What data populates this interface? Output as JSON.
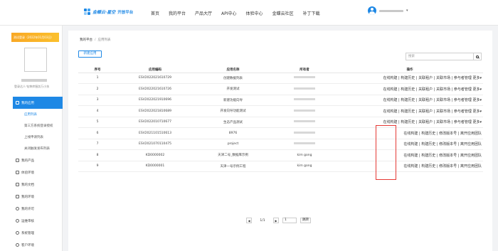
{
  "header": {
    "logo_text": "金蝶云·星空",
    "logo_sub": "开放平台",
    "nav": [
      "首页",
      "我的平台",
      "产品大厅",
      "API中心",
      "体验中心",
      "金蝶云社区",
      "补丁下载"
    ]
  },
  "sidebar": {
    "banner": "测试登录（2022年01月03日）",
    "profile_desc": "登录达人·钻坤库服务万小技",
    "items": [
      {
        "label": "我的应用",
        "icon": "app-icon",
        "active": true
      },
      {
        "label": "应用列表",
        "sub": true,
        "current": true
      },
      {
        "label": "第三方系统登录授权",
        "sub": true
      },
      {
        "label": "上线申请列表",
        "sub": true
      },
      {
        "label": "关闭触发发布列表",
        "sub": true
      },
      {
        "label": "我的产品",
        "icon": "product-icon"
      },
      {
        "label": "体验环境",
        "icon": "env-icon"
      },
      {
        "label": "我的文档",
        "icon": "doc-icon"
      },
      {
        "label": "我的环境",
        "icon": "server-icon"
      },
      {
        "label": "我的许可",
        "icon": "license-icon"
      },
      {
        "label": "运维审核",
        "icon": "audit-icon"
      },
      {
        "label": "系统管理",
        "icon": "settings-icon"
      },
      {
        "label": "客户环境",
        "icon": "customer-icon"
      }
    ]
  },
  "main": {
    "breadcrumb": [
      "我的平台",
      "应用列表"
    ],
    "create_button": "新建应用",
    "search_placeholder": "搜索",
    "table": {
      "headers": [
        "序号",
        "应用编码",
        "应用名称",
        "所有者",
        "操作"
      ],
      "rows": [
        {
          "no": "1",
          "code": "ESV2022021610729",
          "name": "创建数据列表",
          "owner": "",
          "ops": "在线构建 | 构建历史 | 关联租户 | 关联市场 | 参与者管理  更多▾"
        },
        {
          "no": "2",
          "code": "ESV2022021610726",
          "name": "开发测试",
          "owner": "",
          "ops": "在线构建 | 构建历史 | 关联租户 | 关联市场 | 参与者管理  更多▾"
        },
        {
          "no": "3",
          "code": "ESV2022021910696",
          "name": "新建功能向导",
          "owner": "",
          "ops": "在线构建 | 构建历史 | 关联租户 | 关联市场 | 参与者管理  更多▾"
        },
        {
          "no": "4",
          "code": "ESV2022021810689",
          "name": "开发向导功能测试",
          "owner": "",
          "ops": "在线构建 | 构建历史 | 关联租户 | 关联市场 | 参与者管理  更多▾"
        },
        {
          "no": "5",
          "code": "ESV2022010710677",
          "name": "生态产品测试",
          "owner": "",
          "ops": "在线构建 | 构建历史 | 关联租户 | 关联市场 | 参与者管理  更多▾"
        },
        {
          "no": "6",
          "code": "ESV2021101510613",
          "name": "8976",
          "owner": "",
          "ops": "在线构建 | 构建历史 | 修改版本号 | 离开应用团队"
        },
        {
          "no": "7",
          "code": "ESV2021070110475",
          "name": "project",
          "owner": "",
          "ops": "在线构建 | 构建历史 | 修改版本号 | 离开应用团队"
        },
        {
          "no": "8",
          "code": "KD0000002",
          "name": "天津二号_数据库示例",
          "owner": "kim gong",
          "ops": "在线构建 | 构建历史 | 修改版本号 | 离开应用团队"
        },
        {
          "no": "9",
          "code": "KD0000001",
          "name": "天津一号示例工程",
          "owner": "kim gong",
          "ops": "在线构建 | 构建历史 | 修改版本号 | 离开应用团队"
        }
      ]
    },
    "pager": {
      "prev": "◀",
      "next": "▶",
      "status": "1/1",
      "page_input": "1",
      "go_label": "跳转"
    }
  }
}
